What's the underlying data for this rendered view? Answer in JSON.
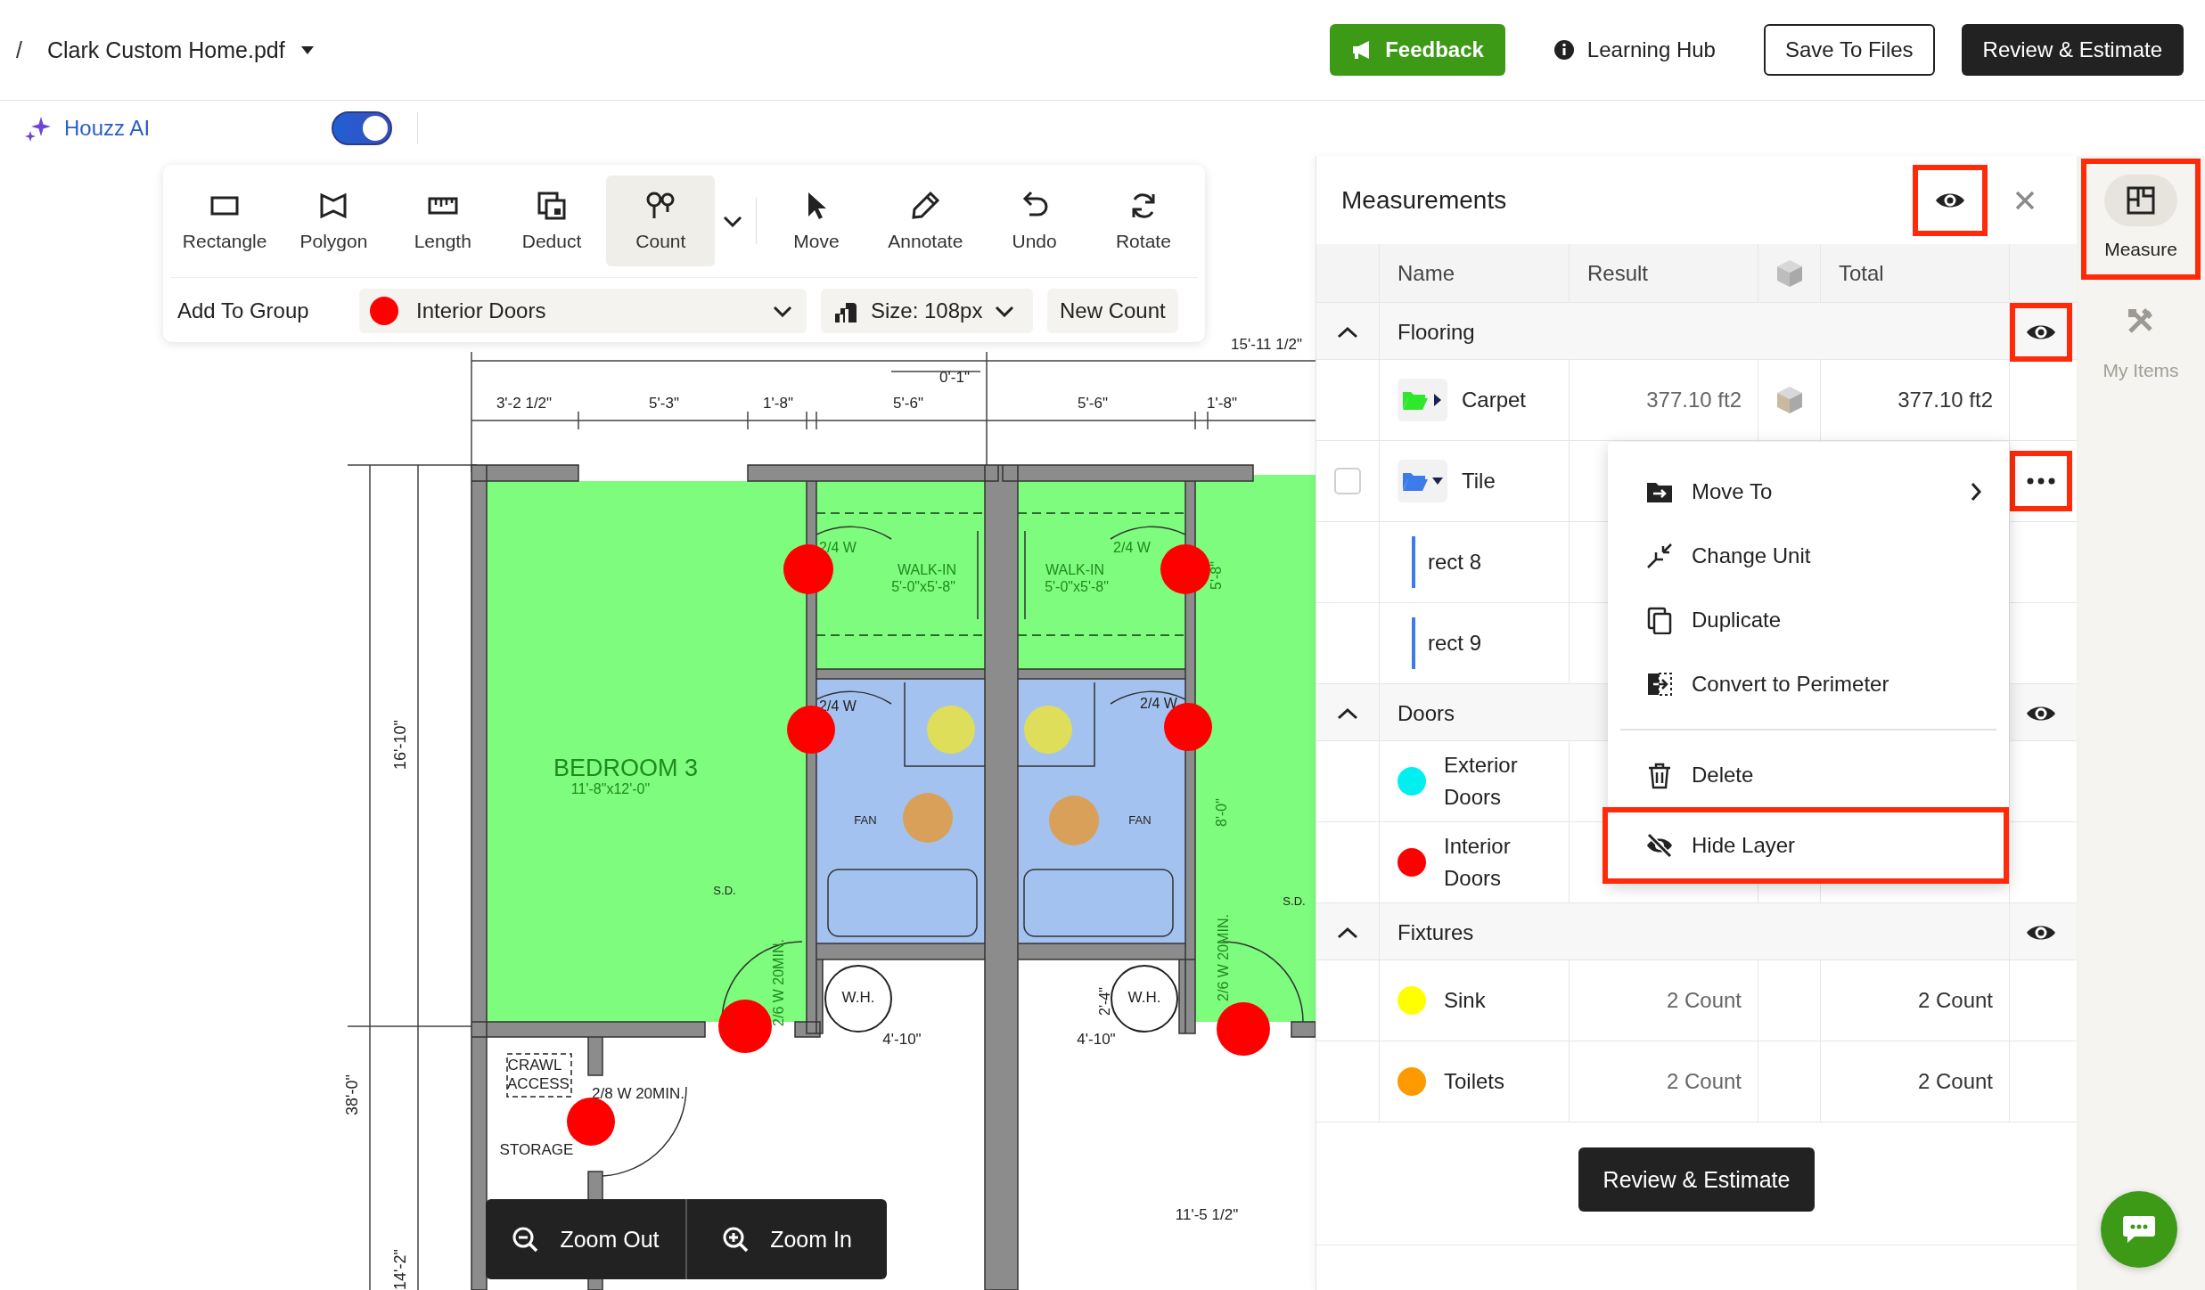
{
  "breadcrumb": {
    "separator": "/",
    "file_name": "Clark Custom Home.pdf"
  },
  "header_actions": [
    {
      "kind": "feedback",
      "label": "Feedback"
    },
    {
      "kind": "link",
      "label": "Learning Hub"
    },
    {
      "kind": "outline",
      "label": "Save To Files"
    },
    {
      "kind": "primary",
      "label": "Review & Estimate"
    }
  ],
  "ai_bar": {
    "label": "Houzz AI",
    "on": true
  },
  "toolbar": {
    "tools": [
      {
        "label": "Rectangle",
        "selected": false
      },
      {
        "label": "Polygon",
        "selected": false
      },
      {
        "label": "Length",
        "selected": false
      },
      {
        "label": "Deduct",
        "selected": false
      },
      {
        "label": "Count",
        "selected": true
      },
      {
        "label": "Move",
        "selected": false
      },
      {
        "label": "Annotate",
        "selected": false
      },
      {
        "label": "Undo",
        "selected": false
      },
      {
        "label": "Rotate",
        "selected": false
      }
    ],
    "group_label": "Add To Group",
    "group": {
      "value": "Interior Doors",
      "color": "#ff0000"
    },
    "size": "Size: 108px",
    "new_count": "New Count"
  },
  "plan": {
    "labels": [
      {
        "text": "15'-11 1/2\""
      },
      {
        "text": "0'-1\""
      },
      {
        "text": "3'-2 1/2\""
      },
      {
        "text": "5'-3\""
      },
      {
        "text": "1'-8\""
      },
      {
        "text": "5'-6\""
      },
      {
        "text": "5'-6\""
      },
      {
        "text": "1'-8\""
      },
      {
        "text": "16'-10\""
      },
      {
        "text": "38'-0\""
      },
      {
        "text": "14'-2\""
      },
      {
        "text": "BEDROOM 3"
      },
      {
        "text": "11'-8\"x12'-0\""
      },
      {
        "text": "2/4 W"
      },
      {
        "text": "WALK-IN"
      },
      {
        "text": "5'-0\"x5'-8\""
      },
      {
        "text": "2/4 W"
      },
      {
        "text": "WALK-IN"
      },
      {
        "text": "5'-0\"x5'-8\""
      },
      {
        "text": "5'-8\""
      },
      {
        "text": "2/4 W"
      },
      {
        "text": "2/4 W"
      },
      {
        "text": "FAN"
      },
      {
        "text": "FAN"
      },
      {
        "text": "8'-0\""
      },
      {
        "text": "S.D."
      },
      {
        "text": "S.D."
      },
      {
        "text": "2/6 W 20MIN."
      },
      {
        "text": "2/6 W 20MIN."
      },
      {
        "text": "W.H."
      },
      {
        "text": "W.H."
      },
      {
        "text": "2'-4\""
      },
      {
        "text": "4'-10\""
      },
      {
        "text": "4'-10\""
      },
      {
        "text": "CRAWL"
      },
      {
        "text": "ACCESS"
      },
      {
        "text": "2/8 W 20MIN."
      },
      {
        "text": "STORAGE"
      },
      {
        "text": "11'-5 1/2\""
      }
    ],
    "markers": [
      {
        "color": "#ff0000"
      },
      {
        "color": "#ff0000"
      },
      {
        "color": "#ff0000"
      },
      {
        "color": "#ff0000"
      },
      {
        "color": "#ff0000"
      },
      {
        "color": "#ff0000"
      },
      {
        "color": "#ff0000"
      },
      {
        "color": "#dede5a"
      },
      {
        "color": "#dede5a"
      },
      {
        "color": "#d9a05a"
      },
      {
        "color": "#d9a05a"
      }
    ]
  },
  "zoom_controls": [
    "Zoom Out",
    "Zoom In"
  ],
  "measurements": {
    "title": "Measurements",
    "eye_highlighted": true,
    "columns": [
      "Name",
      "Result",
      "Total"
    ],
    "groups": [
      {
        "name": "Flooring",
        "expanded": true,
        "eye_highlighted": true,
        "items": [
          {
            "kind": "folder",
            "name": "Carpet",
            "color": "#2ee82e",
            "expanded": false,
            "result": "377.10 ft2",
            "total": "377.10 ft2"
          },
          {
            "kind": "folder",
            "name": "Tile",
            "color": "#3b7bea",
            "expanded": true,
            "checked": false,
            "more_button": {
              "highlighted": true
            },
            "children": [
              {
                "name": "rect 8"
              },
              {
                "name": "rect 9"
              }
            ]
          }
        ]
      },
      {
        "name": "Doors",
        "expanded": true,
        "eye_highlighted": false,
        "items": [
          {
            "kind": "count",
            "name": "Exterior Doors",
            "color": "#00f0f0"
          },
          {
            "kind": "count",
            "name": "Interior Doors",
            "color": "#ff0000"
          }
        ]
      },
      {
        "name": "Fixtures",
        "expanded": true,
        "eye_highlighted": false,
        "items": [
          {
            "kind": "count",
            "name": "Sink",
            "color": "#ffff00",
            "result": "2 Count",
            "total": "2 Count"
          },
          {
            "kind": "count",
            "name": "Toilets",
            "color": "#ff9900",
            "result": "2 Count",
            "total": "2 Count"
          }
        ]
      }
    ],
    "button": "Review & Estimate"
  },
  "context_menu": {
    "sections": [
      [
        {
          "label": "Move To",
          "submenu": true,
          "highlighted": false
        },
        {
          "label": "Change Unit",
          "submenu": false,
          "highlighted": false
        },
        {
          "label": "Duplicate",
          "submenu": false,
          "highlighted": false
        },
        {
          "label": "Convert to Perimeter",
          "submenu": false,
          "highlighted": false
        }
      ],
      [
        {
          "label": "Delete",
          "submenu": false,
          "highlighted": false
        },
        {
          "label": "Hide Layer",
          "submenu": false,
          "highlighted": true
        }
      ]
    ]
  },
  "rail": [
    {
      "label": "Measure",
      "selected": true,
      "highlighted": true
    },
    {
      "label": "My Items",
      "selected": false,
      "highlighted": false
    }
  ]
}
